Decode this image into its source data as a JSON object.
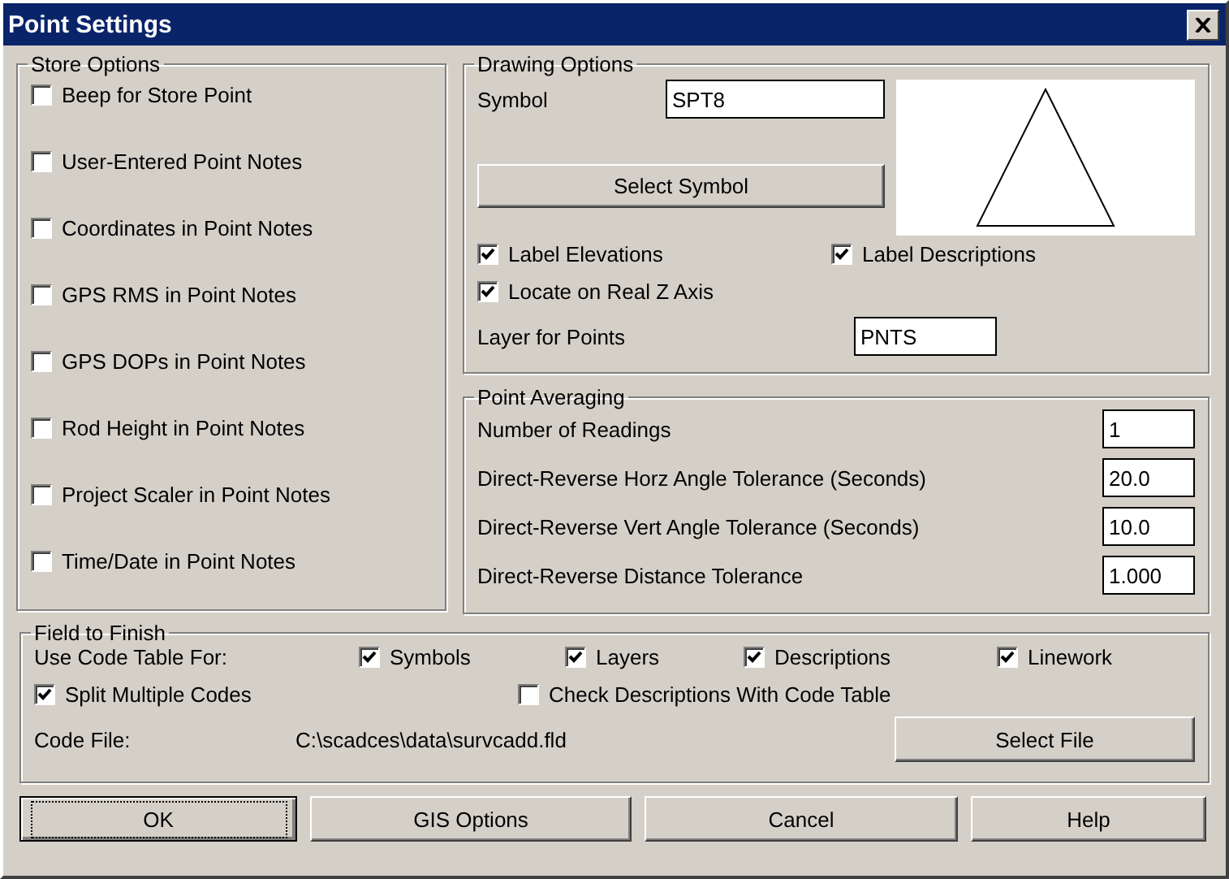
{
  "window": {
    "title": "Point Settings"
  },
  "store_options": {
    "title": "Store Options",
    "items": [
      {
        "label": "Beep for Store Point",
        "checked": false
      },
      {
        "label": "User-Entered Point Notes",
        "checked": false
      },
      {
        "label": "Coordinates in Point Notes",
        "checked": false
      },
      {
        "label": "GPS RMS in Point Notes",
        "checked": false
      },
      {
        "label": "GPS DOPs in Point Notes",
        "checked": false
      },
      {
        "label": "Rod Height in Point Notes",
        "checked": false
      },
      {
        "label": "Project Scaler in Point Notes",
        "checked": false
      },
      {
        "label": "Time/Date in Point Notes",
        "checked": false
      }
    ]
  },
  "drawing_options": {
    "title": "Drawing Options",
    "symbol_label": "Symbol",
    "symbol_value": "SPT8",
    "select_symbol": "Select Symbol",
    "checkboxes": [
      {
        "label": "Label Elevations",
        "checked": true
      },
      {
        "label": "Label Descriptions",
        "checked": true
      },
      {
        "label": "Locate on Real Z Axis",
        "checked": true
      }
    ],
    "layer_label": "Layer for Points",
    "layer_value": "PNTS"
  },
  "point_averaging": {
    "title": "Point Averaging",
    "rows": [
      {
        "label": "Number of Readings",
        "value": "1"
      },
      {
        "label": "Direct-Reverse Horz Angle Tolerance (Seconds)",
        "value": "20.0"
      },
      {
        "label": "Direct-Reverse Vert Angle Tolerance (Seconds)",
        "value": "10.0"
      },
      {
        "label": "Direct-Reverse Distance Tolerance",
        "value": "1.000"
      }
    ]
  },
  "field_to_finish": {
    "title": "Field to Finish",
    "use_label": "Use Code Table For:",
    "use_items": [
      {
        "label": "Symbols",
        "checked": true
      },
      {
        "label": "Layers",
        "checked": true
      },
      {
        "label": "Descriptions",
        "checked": true
      },
      {
        "label": "Linework",
        "checked": true
      }
    ],
    "split": {
      "label": "Split Multiple Codes",
      "checked": true
    },
    "check_desc": {
      "label": "Check Descriptions With Code Table",
      "checked": false
    },
    "code_file_label": "Code File:",
    "code_file_value": "C:\\scadces\\data\\survcadd.fld",
    "select_file": "Select File"
  },
  "buttons": [
    {
      "label": "OK",
      "default": true
    },
    {
      "label": "GIS Options",
      "default": false
    },
    {
      "label": "Cancel",
      "default": false
    },
    {
      "label": "Help",
      "default": false
    }
  ]
}
